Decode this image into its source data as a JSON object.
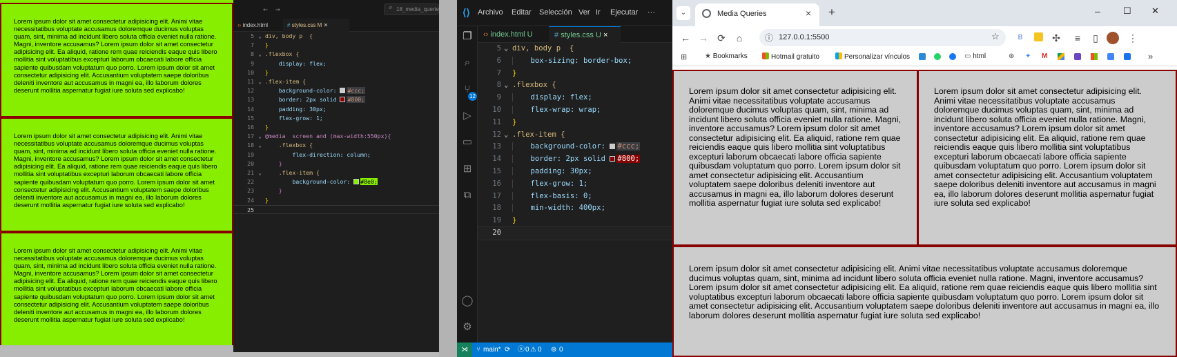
{
  "lorem": "Lorem ipsum dolor sit amet consectetur adipisicing elit. Animi vitae necessitatibus voluptate accusamus doloremque ducimus voluptas quam, sint, minima ad incidunt libero soluta officia eveniet nulla ratione. Magni, inventore accusamus? Lorem ipsum dolor sit amet consectetur adipisicing elit. Ea aliquid, ratione rem quae reiciendis eaque quis libero mollitia sint voluptatibus excepturi laborum obcaecati labore officia sapiente quibusdam voluptatum quo porro. Lorem ipsum dolor sit amet consectetur adipisicing elit. Accusantium voluptatem saepe doloribus deleniti inventore aut accusamus in magni ea, illo laborum dolores deserunt mollitia aspernatur fugiat iure soluta sed explicabo!",
  "colors": {
    "green_item": "#8e0",
    "grey_item": "#ccc",
    "border_red": "#800",
    "vscode_blue": "#0078d4"
  },
  "mini_editor": {
    "search_text": "18_media_queries",
    "tabs": [
      {
        "label": "index.html",
        "icon": "html-icon"
      },
      {
        "label": "styles.css",
        "badge": "M",
        "icon": "css-icon"
      }
    ],
    "lines": [
      {
        "n": "5",
        "text": "div, body p  {"
      },
      {
        "n": "7",
        "text": "}"
      },
      {
        "n": "8",
        "text": ".flexbox {"
      },
      {
        "n": "9",
        "text": "display: flex;"
      },
      {
        "n": "10",
        "text": "}"
      },
      {
        "n": "11",
        "text": ".flex-item {"
      },
      {
        "n": "12",
        "text": "background-color:",
        "val": "#ccc;"
      },
      {
        "n": "13",
        "text": "border: 2px solid",
        "val": "#800;"
      },
      {
        "n": "14",
        "text": "padding: 30px;"
      },
      {
        "n": "15",
        "text": "flex-grow: 1;"
      },
      {
        "n": "16",
        "text": "}"
      },
      {
        "n": "17",
        "text": "@media  screen and (max-width:550px){"
      },
      {
        "n": "18",
        "text": ".flexbox {"
      },
      {
        "n": "19",
        "text": "flex-direction: column;"
      },
      {
        "n": "20",
        "text": "}"
      },
      {
        "n": "21",
        "text": ".flex-item {"
      },
      {
        "n": "22",
        "text": "background-color:",
        "val": "#8e0;"
      },
      {
        "n": "23",
        "text": "}"
      },
      {
        "n": "24",
        "text": "}"
      },
      {
        "n": "25",
        "text": ""
      }
    ]
  },
  "vscode": {
    "menu": [
      "Archivo",
      "Editar",
      "Selección",
      "Ver",
      "Ir",
      "Ejecutar",
      "···"
    ],
    "tabs": [
      {
        "label": "index.html",
        "badge": "U",
        "icon": "html-icon"
      },
      {
        "label": "styles.css",
        "badge": "U",
        "icon": "css-icon",
        "close": "×"
      }
    ],
    "scm_badge": "12",
    "lines": [
      {
        "n": "5",
        "text": "div, body p  {"
      },
      {
        "n": "6",
        "text": "box-sizing: border-box;"
      },
      {
        "n": "7",
        "text": "}"
      },
      {
        "n": "8",
        "text": ".flexbox {"
      },
      {
        "n": "9",
        "text": "display: flex;"
      },
      {
        "n": "10",
        "text": "flex-wrap: wrap;"
      },
      {
        "n": "11",
        "text": "}"
      },
      {
        "n": "12",
        "text": ".flex-item {"
      },
      {
        "n": "13",
        "text": "background-color:",
        "val": "#ccc;"
      },
      {
        "n": "14",
        "text": "border: 2px solid",
        "val": "#800;"
      },
      {
        "n": "15",
        "text": "padding: 30px;"
      },
      {
        "n": "16",
        "text": "flex-grow: 1;"
      },
      {
        "n": "17",
        "text": "flex-basis: 0;"
      },
      {
        "n": "18",
        "text": "min-width: 400px;"
      },
      {
        "n": "19",
        "text": "}"
      },
      {
        "n": "20",
        "text": ""
      }
    ],
    "status": {
      "branch": "main*",
      "errors": "0",
      "warnings": "0",
      "ports": "0"
    }
  },
  "browser": {
    "tab_title": "Media Queries",
    "tab_close": "×",
    "new_tab": "+",
    "url": "127.0.0.1:5500",
    "window_controls": [
      "–",
      "☐",
      "✕"
    ],
    "bookmarks": [
      {
        "label": "Bookmarks",
        "icon": "star-icon"
      },
      {
        "label": "Hotmail gratuito",
        "icon": "microsoft-icon"
      },
      {
        "label": "Personalizar vínculos",
        "icon": "microsoft-icon"
      },
      {
        "label": "html",
        "icon": "folder-icon"
      }
    ],
    "more_bookmarks": "»"
  }
}
